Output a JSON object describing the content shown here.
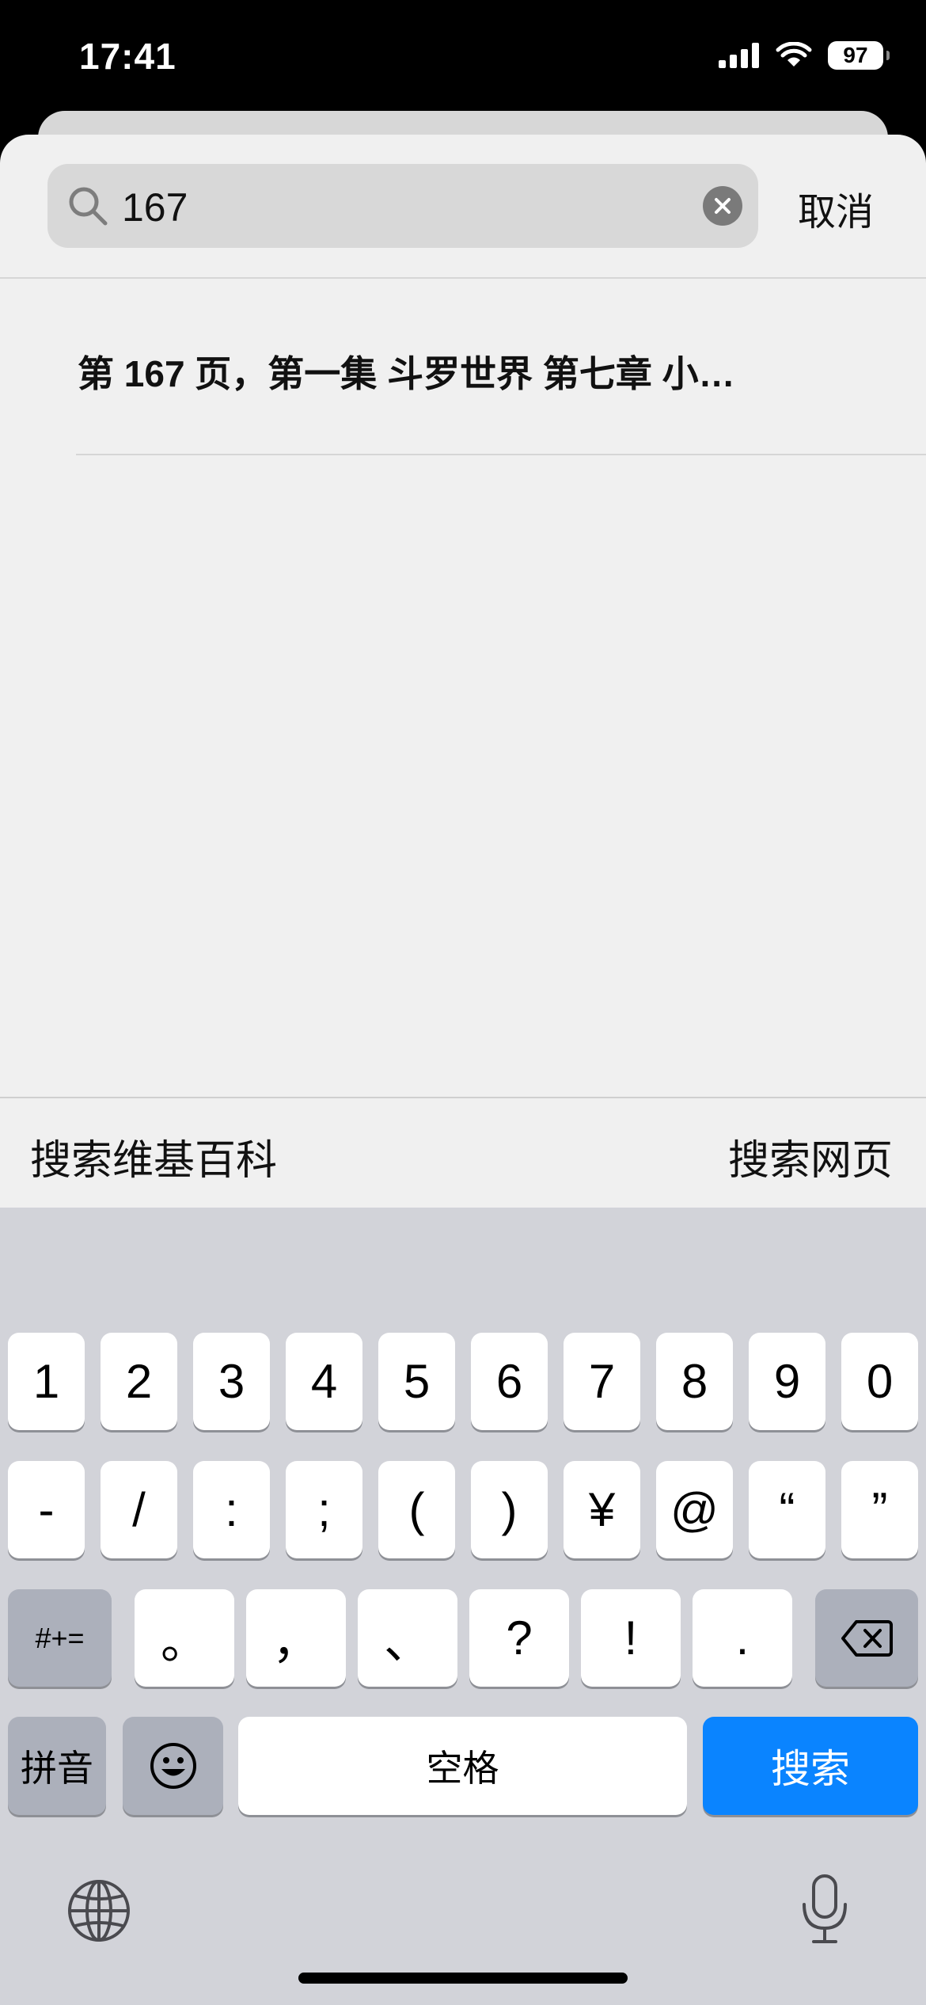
{
  "status": {
    "time": "17:41",
    "battery": "97"
  },
  "search": {
    "value": "167",
    "cancel_label": "取消"
  },
  "results": [
    {
      "text": "第 167 页，第一集 斗罗世界 第七章 小…"
    }
  ],
  "suggestions": {
    "left": "搜索维基百科",
    "right": "搜索网页"
  },
  "keyboard": {
    "row1": [
      "1",
      "2",
      "3",
      "4",
      "5",
      "6",
      "7",
      "8",
      "9",
      "0"
    ],
    "row2": [
      "-",
      "/",
      ":",
      ";",
      "(",
      ")",
      "¥",
      "@",
      "“",
      "”"
    ],
    "row3": [
      "#+=",
      "。",
      "，",
      "、",
      "?",
      "!",
      "."
    ],
    "pinyin_label": "拼音",
    "space_label": "空格",
    "search_label": "搜索"
  },
  "colors": {
    "accent": "#0a84ff",
    "keyboard_bg": "#d2d3d9",
    "sheet_bg": "#f0f0f0"
  }
}
